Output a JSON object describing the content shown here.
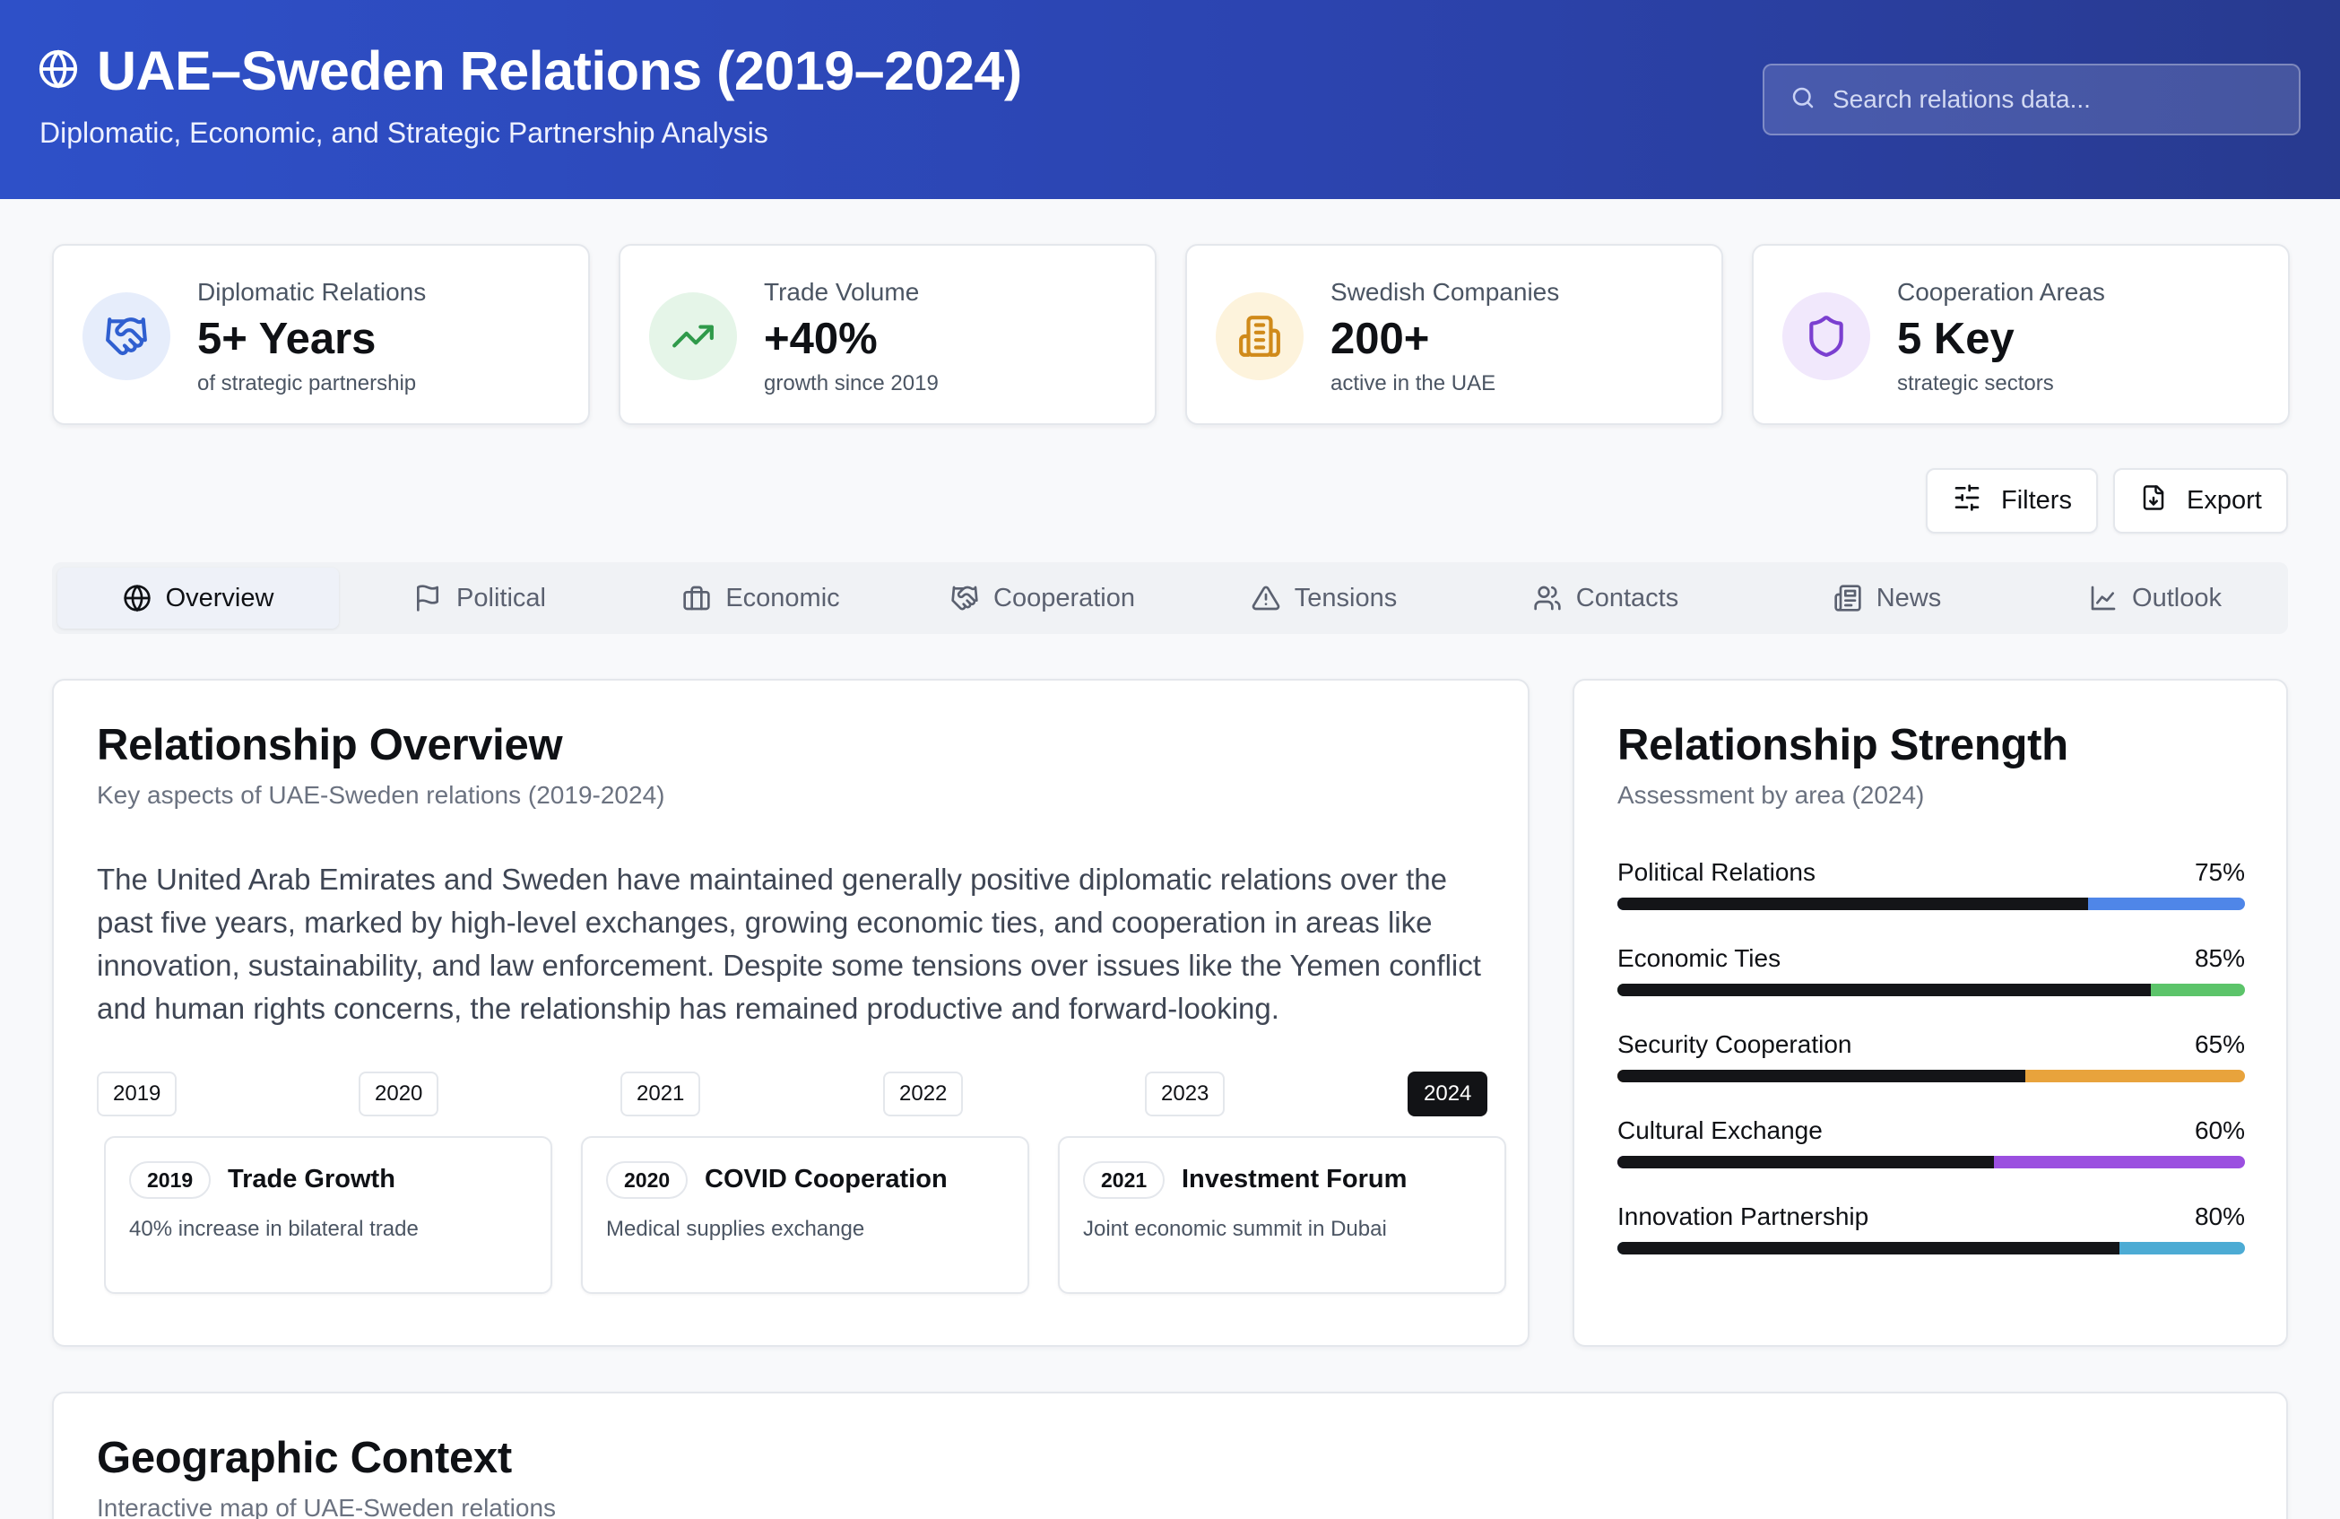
{
  "header": {
    "title": "UAE–Sweden Relations (2019–2024)",
    "subtitle": "Diplomatic, Economic, and Strategic Partnership Analysis",
    "search_placeholder": "Search relations data..."
  },
  "stats": [
    {
      "label": "Diplomatic Relations",
      "value": "5+ Years",
      "sub": "of strategic partnership",
      "icon": "handshake-icon",
      "color": "#2f5fd0",
      "bg": "#e6edfb"
    },
    {
      "label": "Trade Volume",
      "value": "+40%",
      "sub": "growth since 2019",
      "icon": "trending-up-icon",
      "color": "#2f9a4a",
      "bg": "#e5f5e8"
    },
    {
      "label": "Swedish Companies",
      "value": "200+",
      "sub": "active in the UAE",
      "icon": "building-icon",
      "color": "#d08a1a",
      "bg": "#fdf3dc"
    },
    {
      "label": "Cooperation Areas",
      "value": "5 Key",
      "sub": "strategic sectors",
      "icon": "shield-icon",
      "color": "#7b3fd0",
      "bg": "#f1e8fc"
    }
  ],
  "actions": {
    "filters": "Filters",
    "export": "Export"
  },
  "tabs": [
    "Overview",
    "Political",
    "Economic",
    "Cooperation",
    "Tensions",
    "Contacts",
    "News",
    "Outlook"
  ],
  "overview": {
    "title": "Relationship Overview",
    "subtitle": "Key aspects of UAE-Sweden relations (2019-2024)",
    "description": "The United Arab Emirates and Sweden have maintained generally positive diplomatic relations over the past five years, marked by high-level exchanges, growing economic ties, and cooperation in areas like innovation, sustainability, and law enforcement. Despite some tensions over issues like the Yemen conflict and human rights concerns, the relationship has remained productive and forward-looking.",
    "years": [
      "2019",
      "2020",
      "2021",
      "2022",
      "2023",
      "2024"
    ],
    "selected_year": "2024",
    "events": [
      {
        "year": "2019",
        "title": "Trade Growth",
        "desc": "40% increase in bilateral trade"
      },
      {
        "year": "2020",
        "title": "COVID Cooperation",
        "desc": "Medical supplies exchange"
      },
      {
        "year": "2021",
        "title": "Investment Forum",
        "desc": "Joint economic summit in Dubai"
      }
    ]
  },
  "strength": {
    "title": "Relationship Strength",
    "subtitle": "Assessment by area (2024)",
    "items": [
      {
        "label": "Political Relations",
        "pct": "75%",
        "value": 75,
        "color": "#4f86e8"
      },
      {
        "label": "Economic Ties",
        "pct": "85%",
        "value": 85,
        "color": "#5cc46a"
      },
      {
        "label": "Security Cooperation",
        "pct": "65%",
        "value": 65,
        "color": "#e8a33c"
      },
      {
        "label": "Cultural Exchange",
        "pct": "60%",
        "value": 60,
        "color": "#9b4fe0"
      },
      {
        "label": "Innovation Partnership",
        "pct": "80%",
        "value": 80,
        "color": "#4cabd4"
      }
    ]
  },
  "geo": {
    "title": "Geographic Context",
    "subtitle": "Interactive map of UAE-Sweden relations"
  }
}
